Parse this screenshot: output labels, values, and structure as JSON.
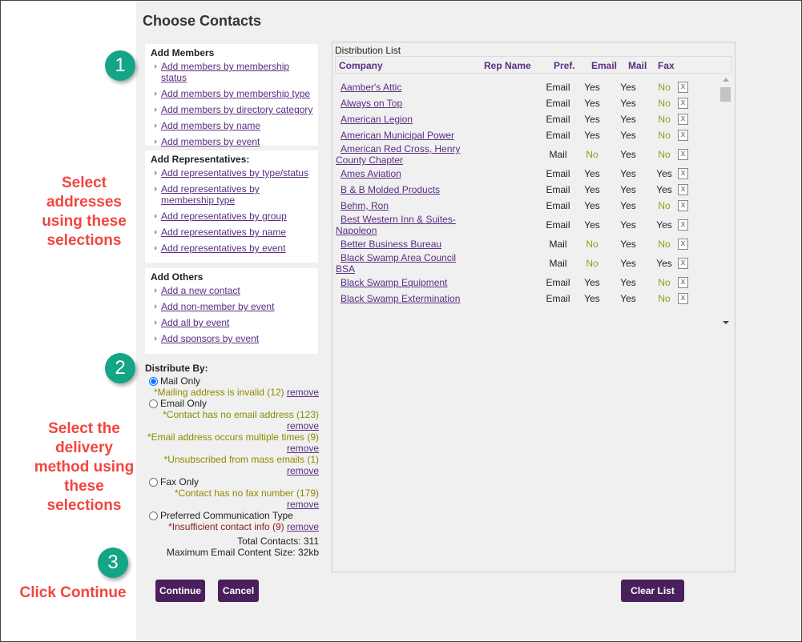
{
  "title": "Choose Contacts",
  "annotations": {
    "step1": "1",
    "step2": "2",
    "step3": "3",
    "text1": "Select addresses using these selections",
    "text2": "Select the delivery method using these selections",
    "text3": "Click Continue"
  },
  "members": {
    "heading": "Add Members",
    "links": [
      "Add members by membership status",
      "Add members by membership type",
      "Add members by directory category",
      "Add members by name",
      "Add members by event"
    ]
  },
  "reps": {
    "heading": "Add Representatives:",
    "links": [
      "Add representatives by type/status",
      "Add representatives by membership type",
      "Add representatives by group",
      "Add representatives by name",
      "Add representatives by event"
    ]
  },
  "others": {
    "heading": "Add Others",
    "links": [
      "Add a new contact",
      "Add non-member by event",
      "Add all by event",
      "Add sponsors by event"
    ]
  },
  "distribute": {
    "heading": "Distribute By:",
    "remove": "remove",
    "options": [
      {
        "label": "Mail Only",
        "checked": true,
        "warnings": [
          {
            "text": "*Mailing address is invalid (12)"
          }
        ]
      },
      {
        "label": "Email Only",
        "checked": false,
        "warnings": [
          {
            "text": "*Contact has no email address (123)"
          },
          {
            "text": "*Email address occurs multiple times (9)"
          },
          {
            "text": "*Unsubscribed from mass emails (1)"
          }
        ]
      },
      {
        "label": "Fax Only",
        "checked": false,
        "warnings": [
          {
            "text": "*Contact has no fax number (179)"
          }
        ]
      },
      {
        "label": "Preferred Communication Type",
        "checked": false,
        "warnings": [
          {
            "text": "*Insufficient contact info (9)"
          }
        ]
      }
    ],
    "total": "Total Contacts: 311",
    "max_size": "Maximum Email Content Size: 32kb"
  },
  "buttons": {
    "continue": "Continue",
    "cancel": "Cancel",
    "clear": "Clear List"
  },
  "list": {
    "caption": "Distribution List",
    "columns": [
      "Company",
      "Rep Name",
      "Pref.",
      "Email",
      "Mail",
      "Fax"
    ],
    "remove_label": "x",
    "rows": [
      {
        "company": "Aamber's Attic",
        "rep": "",
        "pref": "Email",
        "email": "Yes",
        "mail": "Yes",
        "fax": "No"
      },
      {
        "company": "Always on Top",
        "rep": "",
        "pref": "Email",
        "email": "Yes",
        "mail": "Yes",
        "fax": "No"
      },
      {
        "company": "American Legion",
        "rep": "",
        "pref": "Email",
        "email": "Yes",
        "mail": "Yes",
        "fax": "No"
      },
      {
        "company": "American Municipal Power",
        "rep": "",
        "pref": "Email",
        "email": "Yes",
        "mail": "Yes",
        "fax": "No"
      },
      {
        "company": "American Red Cross, Henry County Chapter",
        "rep": "",
        "pref": "Mail",
        "email": "No",
        "mail": "Yes",
        "fax": "No"
      },
      {
        "company": "Ames Aviation",
        "rep": "",
        "pref": "Email",
        "email": "Yes",
        "mail": "Yes",
        "fax": "Yes"
      },
      {
        "company": "B & B Molded Products",
        "rep": "",
        "pref": "Email",
        "email": "Yes",
        "mail": "Yes",
        "fax": "Yes"
      },
      {
        "company": "Behm, Ron",
        "rep": "",
        "pref": "Email",
        "email": "Yes",
        "mail": "Yes",
        "fax": "No"
      },
      {
        "company": "Best Western Inn & Suites-Napoleon",
        "rep": "",
        "pref": "Email",
        "email": "Yes",
        "mail": "Yes",
        "fax": "Yes"
      },
      {
        "company": "Better Business Bureau",
        "rep": "",
        "pref": "Mail",
        "email": "No",
        "mail": "Yes",
        "fax": "No"
      },
      {
        "company": "Black Swamp Area Council BSA",
        "rep": "",
        "pref": "Mail",
        "email": "No",
        "mail": "Yes",
        "fax": "Yes"
      },
      {
        "company": "Black Swamp Equipment",
        "rep": "",
        "pref": "Email",
        "email": "Yes",
        "mail": "Yes",
        "fax": "No"
      },
      {
        "company": "Black Swamp Extermination",
        "rep": "",
        "pref": "Email",
        "email": "Yes",
        "mail": "Yes",
        "fax": "No"
      }
    ]
  }
}
